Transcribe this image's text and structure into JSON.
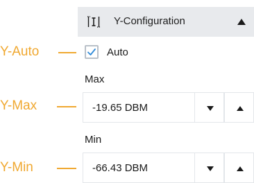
{
  "callouts": {
    "auto": "Y-Auto",
    "max": "Y-Max",
    "min": "Y-Min"
  },
  "header": {
    "title": "Y-Configuration",
    "icon": "y-axis-icon",
    "collapse_icon": "collapse-triangle-icon"
  },
  "auto": {
    "label": "Auto",
    "checked": true
  },
  "max": {
    "label": "Max",
    "value": "-19.65 DBM"
  },
  "min": {
    "label": "Min",
    "value": "-66.43 DBM"
  },
  "colors": {
    "callout": "#f0a830",
    "header_bg": "#e8eaed",
    "check": "#2f8ad8"
  }
}
